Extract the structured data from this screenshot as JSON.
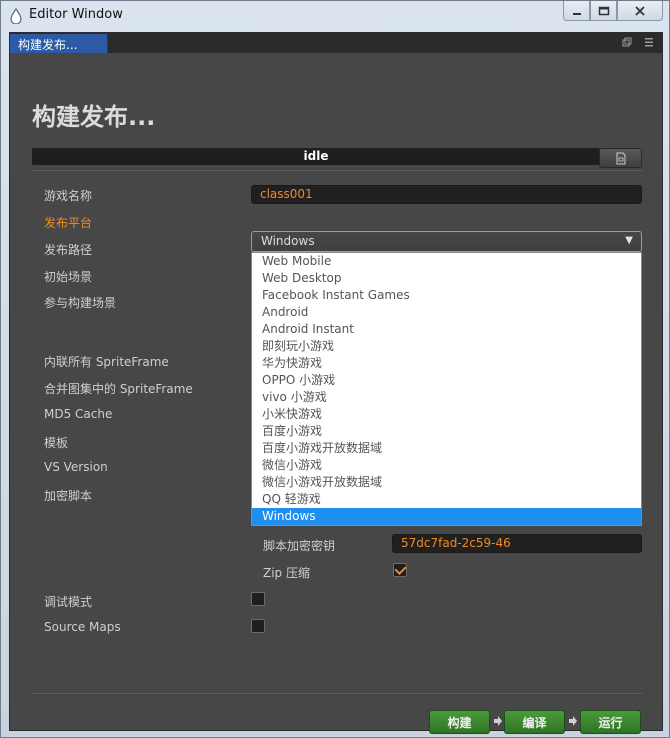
{
  "window": {
    "title": "Editor Window",
    "buttons": [
      "minimize",
      "maximize",
      "close"
    ]
  },
  "tab": {
    "label": "构建发布..."
  },
  "header": {
    "title": "构建发布...",
    "progress_label": "idle"
  },
  "form": {
    "game_name": {
      "label": "游戏名称",
      "value": "class001"
    },
    "platform": {
      "label": "发布平台",
      "value": "Windows"
    },
    "build_path": {
      "label": "发布路径"
    },
    "start_scene": {
      "label": "初始场景"
    },
    "scenes": {
      "label": "参与构建场景"
    },
    "inline_sprite": {
      "label": "内联所有 SpriteFrame"
    },
    "merge_sprite": {
      "label": "合并图集中的 SpriteFrame"
    },
    "md5": {
      "label": "MD5 Cache"
    },
    "template": {
      "label": "模板"
    },
    "vs_version": {
      "label": "VS Version"
    },
    "encrypt": {
      "label": "加密脚本"
    },
    "encrypt_key": {
      "label": "脚本加密密钥",
      "value": "57dc7fad-2c59-46"
    },
    "zip": {
      "label": "Zip 压缩",
      "checked": true
    },
    "debug": {
      "label": "调试模式",
      "checked": false
    },
    "source_maps": {
      "label": "Source Maps",
      "checked": false
    }
  },
  "platform_options": [
    "Web Mobile",
    "Web Desktop",
    "Facebook Instant Games",
    "Android",
    "Android Instant",
    "即刻玩小游戏",
    "华为快游戏",
    "OPPO 小游戏",
    "vivo 小游戏",
    "小米快游戏",
    "百度小游戏",
    "百度小游戏开放数据域",
    "微信小游戏",
    "微信小游戏开放数据域",
    "QQ 轻游戏",
    "Windows"
  ],
  "actions": {
    "build": "构建",
    "compile": "编译",
    "run": "运行"
  },
  "colors": {
    "accent": "#f08a24",
    "selected": "#1e8ff0",
    "action_green": "#3c8a30"
  }
}
